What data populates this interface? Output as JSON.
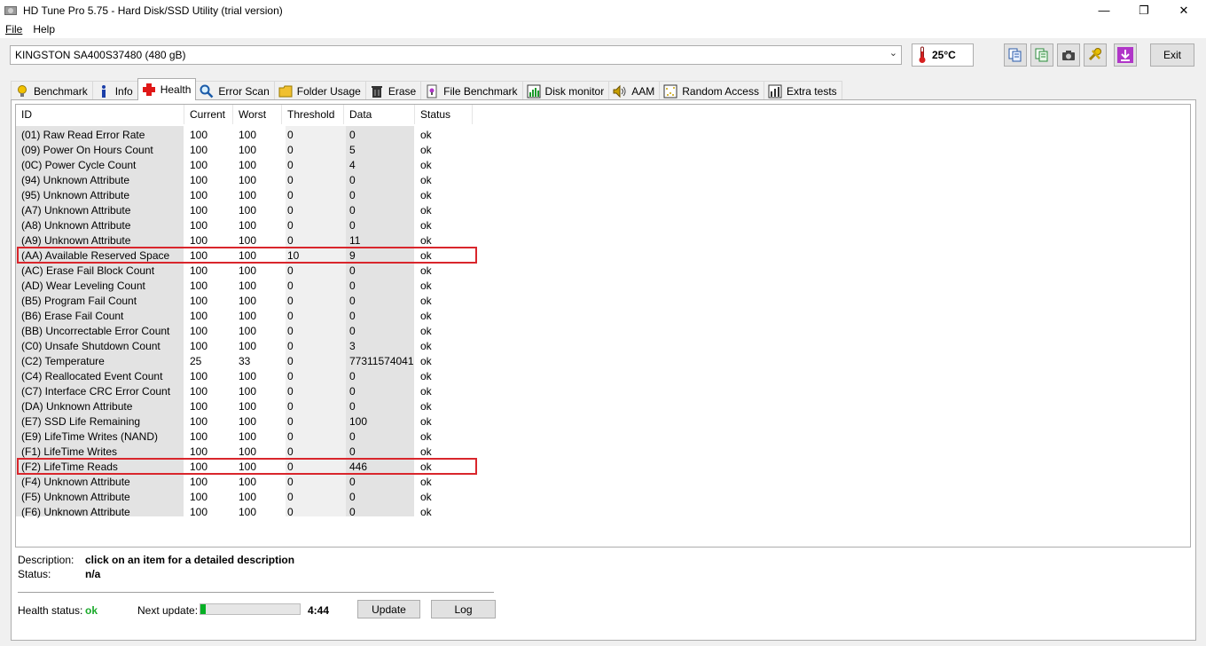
{
  "window": {
    "title": "HD Tune Pro 5.75 - Hard Disk/SSD Utility (trial version)",
    "minimize": "—",
    "maximize": "❐",
    "close": "✕"
  },
  "menu": [
    "File",
    "Help"
  ],
  "toolbar": {
    "drive": "KINGSTON SA400S37480 (480 gB)",
    "temperature": "25°C",
    "exit_label": "Exit",
    "icons": [
      "copy-info-icon",
      "copy-screen-icon",
      "screenshot-camera-icon",
      "options-tools-icon",
      "save-download-icon"
    ]
  },
  "tabs": [
    {
      "label": "Benchmark",
      "icon": "benchmark-icon"
    },
    {
      "label": "Info",
      "icon": "info-icon"
    },
    {
      "label": "Health",
      "icon": "health-cross-icon"
    },
    {
      "label": "Error Scan",
      "icon": "error-scan-icon"
    },
    {
      "label": "Folder Usage",
      "icon": "folder-icon"
    },
    {
      "label": "Erase",
      "icon": "erase-trash-icon"
    },
    {
      "label": "File Benchmark",
      "icon": "file-benchmark-icon"
    },
    {
      "label": "Disk monitor",
      "icon": "disk-monitor-icon"
    },
    {
      "label": "AAM",
      "icon": "speaker-icon"
    },
    {
      "label": "Random Access",
      "icon": "random-access-icon"
    },
    {
      "label": "Extra tests",
      "icon": "extra-tests-icon"
    }
  ],
  "active_tab": "Health",
  "table": {
    "columns": [
      "ID",
      "Current",
      "Worst",
      "Threshold",
      "Data",
      "Status"
    ],
    "rows": [
      [
        "(01) Raw Read Error Rate",
        "100",
        "100",
        "0",
        "0",
        "ok"
      ],
      [
        "(09) Power On Hours Count",
        "100",
        "100",
        "0",
        "5",
        "ok"
      ],
      [
        "(0C) Power Cycle Count",
        "100",
        "100",
        "0",
        "4",
        "ok"
      ],
      [
        "(94) Unknown Attribute",
        "100",
        "100",
        "0",
        "0",
        "ok"
      ],
      [
        "(95) Unknown Attribute",
        "100",
        "100",
        "0",
        "0",
        "ok"
      ],
      [
        "(A7) Unknown Attribute",
        "100",
        "100",
        "0",
        "0",
        "ok"
      ],
      [
        "(A8) Unknown Attribute",
        "100",
        "100",
        "0",
        "0",
        "ok"
      ],
      [
        "(A9) Unknown Attribute",
        "100",
        "100",
        "0",
        "11",
        "ok"
      ],
      [
        "(AA) Available Reserved Space",
        "100",
        "100",
        "10",
        "9",
        "ok"
      ],
      [
        "(AC) Erase Fail Block Count",
        "100",
        "100",
        "0",
        "0",
        "ok"
      ],
      [
        "(AD) Wear Leveling Count",
        "100",
        "100",
        "0",
        "0",
        "ok"
      ],
      [
        "(B5) Program Fail Count",
        "100",
        "100",
        "0",
        "0",
        "ok"
      ],
      [
        "(B6) Erase Fail Count",
        "100",
        "100",
        "0",
        "0",
        "ok"
      ],
      [
        "(BB) Uncorrectable Error Count",
        "100",
        "100",
        "0",
        "0",
        "ok"
      ],
      [
        "(C0) Unsafe Shutdown Count",
        "100",
        "100",
        "0",
        "3",
        "ok"
      ],
      [
        "(C2) Temperature",
        "25",
        "33",
        "0",
        "77311574041",
        "ok"
      ],
      [
        "(C4) Reallocated Event Count",
        "100",
        "100",
        "0",
        "0",
        "ok"
      ],
      [
        "(C7) Interface CRC Error Count",
        "100",
        "100",
        "0",
        "0",
        "ok"
      ],
      [
        "(DA) Unknown Attribute",
        "100",
        "100",
        "0",
        "0",
        "ok"
      ],
      [
        "(E7) SSD Life Remaining",
        "100",
        "100",
        "0",
        "100",
        "ok"
      ],
      [
        "(E9) LifeTime Writes (NAND)",
        "100",
        "100",
        "0",
        "0",
        "ok"
      ],
      [
        "(F1) LifeTime Writes",
        "100",
        "100",
        "0",
        "0",
        "ok"
      ],
      [
        "(F2) LifeTime Reads",
        "100",
        "100",
        "0",
        "446",
        "ok"
      ],
      [
        "(F4) Unknown Attribute",
        "100",
        "100",
        "0",
        "0",
        "ok"
      ],
      [
        "(F5) Unknown Attribute",
        "100",
        "100",
        "0",
        "0",
        "ok"
      ],
      [
        "(F6) Unknown Attribute",
        "100",
        "100",
        "0",
        "0",
        "ok"
      ]
    ],
    "highlighted_rows": [
      8,
      22
    ],
    "highlight_color": "#d9262c"
  },
  "footer": {
    "description_label": "Description:",
    "description_value": "click on an item for a detailed description",
    "status_label": "Status:",
    "status_value": "n/a",
    "health_status_label": "Health status:",
    "health_status_value": "ok",
    "health_status_color": "#1aaa2a",
    "next_update_label": "Next update:",
    "next_update_progress": 0.05,
    "next_update_time": "4:44",
    "update_button": "Update",
    "log_button": "Log"
  }
}
